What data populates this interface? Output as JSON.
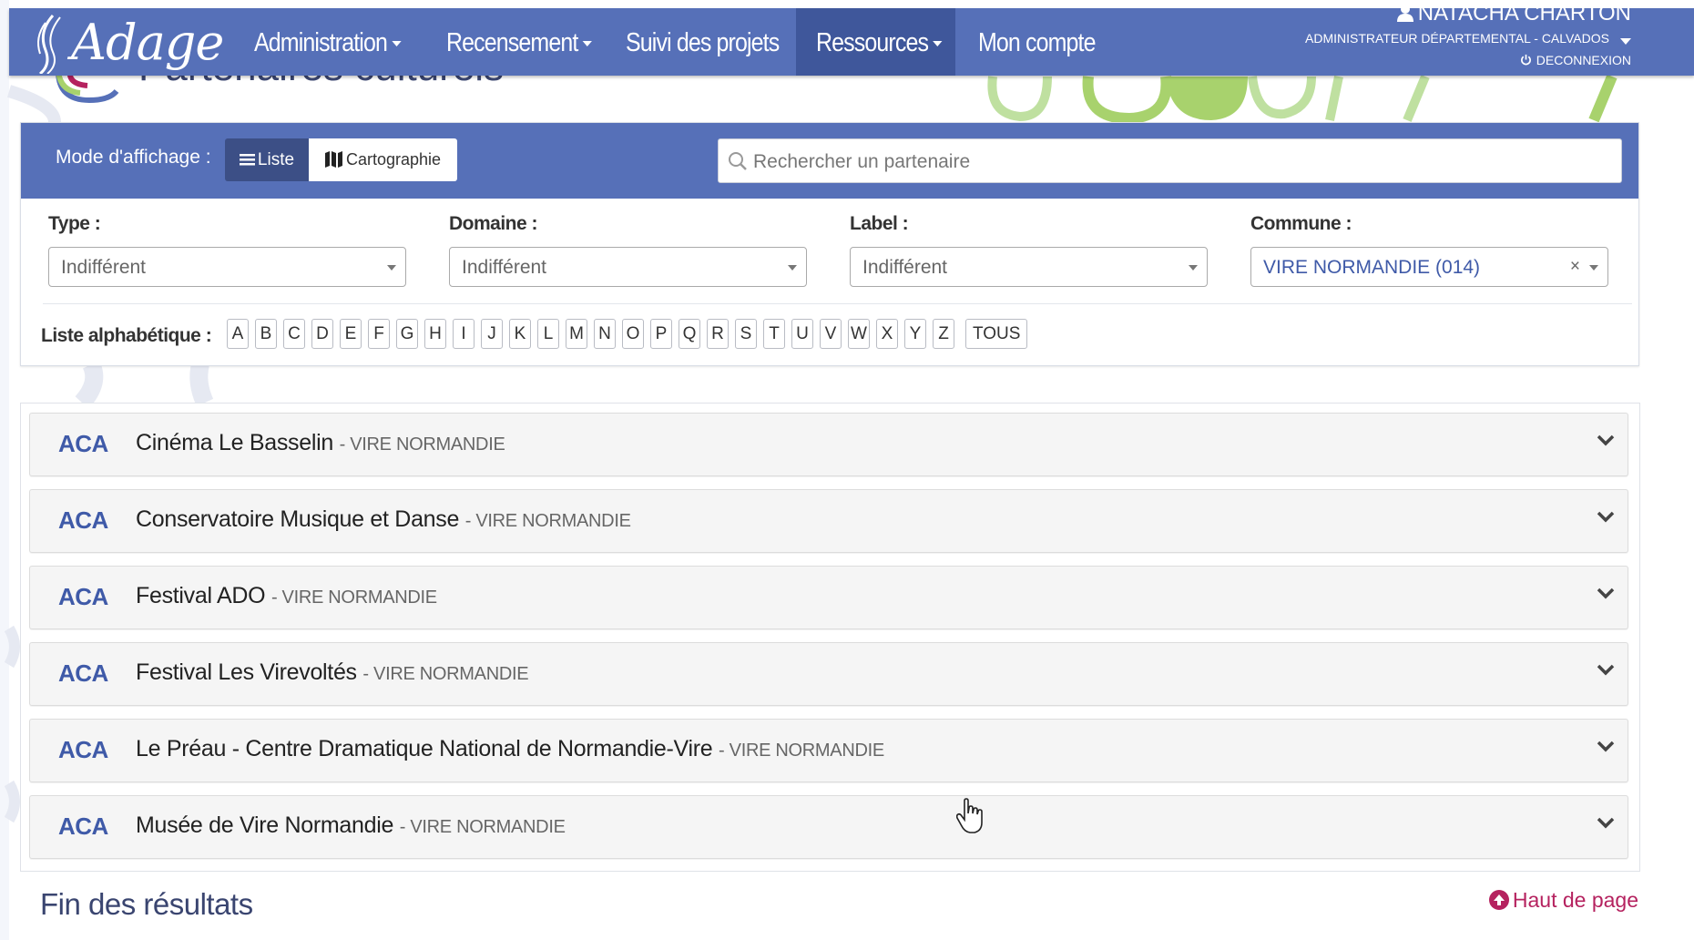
{
  "app": {
    "logo_text": "Adage"
  },
  "nav": {
    "items": [
      {
        "label": "Administration",
        "dropdown": true
      },
      {
        "label": "Recensement",
        "dropdown": true
      },
      {
        "label": "Suivi des projets",
        "dropdown": false
      },
      {
        "label": "Ressources",
        "dropdown": true,
        "active": true
      },
      {
        "label": "Mon compte",
        "dropdown": false
      }
    ]
  },
  "user": {
    "name": "NATACHA CHARTON",
    "role": "ADMINISTRATEUR DÉPARTEMENTAL - CALVADOS",
    "logout_label": "DECONNEXION"
  },
  "page": {
    "title": "Partenaires culturels"
  },
  "filters": {
    "mode_label": "Mode d'affichage :",
    "liste_label": "Liste",
    "carto_label": "Cartographie",
    "search_placeholder": "Rechercher un partenaire",
    "type": {
      "label": "Type :",
      "value": "Indifférent"
    },
    "domaine": {
      "label": "Domaine :",
      "value": "Indifférent"
    },
    "label_filter": {
      "label": "Label :",
      "value": "Indifférent"
    },
    "commune": {
      "label": "Commune :",
      "value": "VIRE NORMANDIE (014)",
      "clear": "×"
    },
    "alpha_label": "Liste alphabétique :",
    "letters": [
      "A",
      "B",
      "C",
      "D",
      "E",
      "F",
      "G",
      "H",
      "I",
      "J",
      "K",
      "L",
      "M",
      "N",
      "O",
      "P",
      "Q",
      "R",
      "S",
      "T",
      "U",
      "V",
      "W",
      "X",
      "Y",
      "Z"
    ],
    "all_label": "TOUS"
  },
  "results": [
    {
      "tag": "ACA",
      "name": "Cinéma Le Basselin",
      "city": "- VIRE NORMANDIE"
    },
    {
      "tag": "ACA",
      "name": "Conservatoire Musique et Danse",
      "city": "- VIRE NORMANDIE"
    },
    {
      "tag": "ACA",
      "name": "Festival ADO",
      "city": "- VIRE NORMANDIE"
    },
    {
      "tag": "ACA",
      "name": "Festival Les Virevoltés",
      "city": "- VIRE NORMANDIE"
    },
    {
      "tag": "ACA",
      "name": "Le Préau - Centre Dramatique National de Normandie-Vire",
      "city": "- VIRE NORMANDIE"
    },
    {
      "tag": "ACA",
      "name": "Musée de Vire Normandie",
      "city": "- VIRE NORMANDIE"
    }
  ],
  "footer": {
    "end_label": "Fin des résultats",
    "top_label": "Haut de page"
  },
  "colors": {
    "brand": "#5670b8",
    "brand_dark": "#3f579b",
    "accent_link": "#b5225f",
    "tag": "#3f5aa8",
    "deco_green": "#a8d26d"
  },
  "icons": [
    "user-icon",
    "power-icon",
    "list-icon",
    "map-icon",
    "search-icon",
    "chevron-down-icon",
    "arrow-up-circle-icon",
    "hand-cursor-icon"
  ]
}
